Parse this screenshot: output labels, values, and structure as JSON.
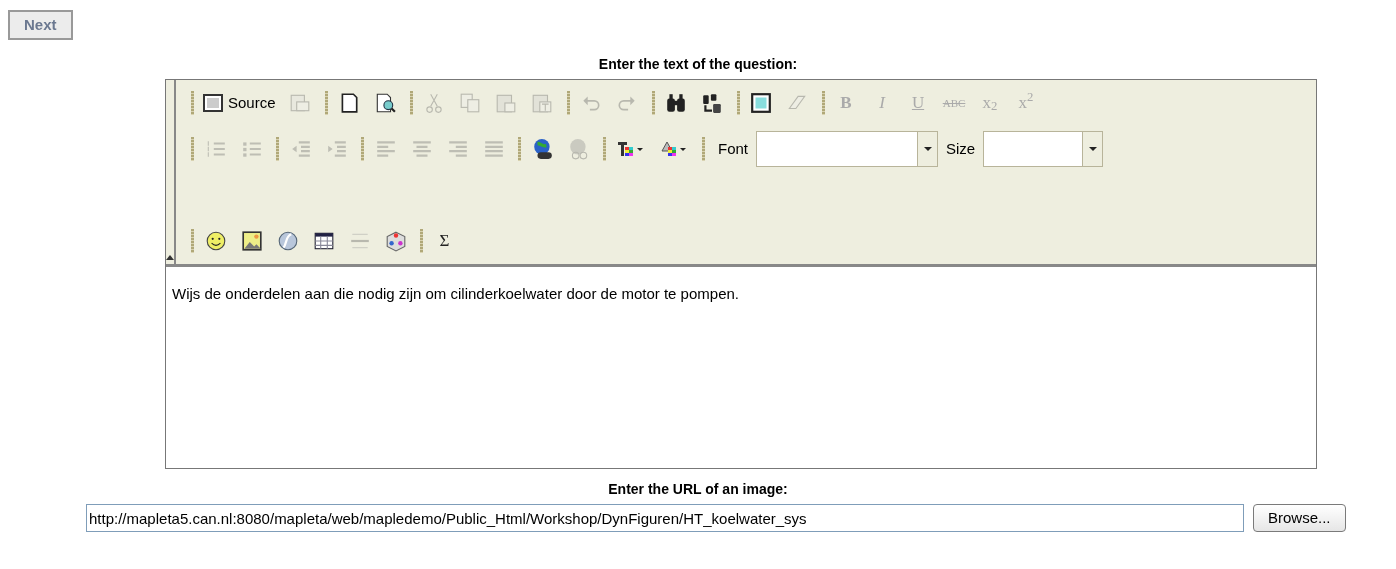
{
  "next_button": {
    "label": "Next",
    "disabled": true
  },
  "question_label": "Enter the text of the question:",
  "editor": {
    "toolbar_rows": [
      {
        "groups": [
          {
            "items": [
              {
                "kind": "text-button",
                "label": "Source",
                "disabled": false
              },
              {
                "kind": "icon",
                "disabled": true
              }
            ]
          },
          {
            "items": [
              {
                "kind": "icon",
                "disabled": false
              },
              {
                "kind": "icon",
                "disabled": false
              }
            ]
          },
          {
            "items": [
              {
                "kind": "icon",
                "disabled": true
              },
              {
                "kind": "icon",
                "disabled": true
              },
              {
                "kind": "icon",
                "disabled": true
              },
              {
                "kind": "icon",
                "disabled": true
              }
            ]
          },
          {
            "items": [
              {
                "kind": "icon",
                "disabled": true
              },
              {
                "kind": "icon",
                "disabled": true
              }
            ]
          },
          {
            "items": [
              {
                "kind": "icon",
                "disabled": false
              },
              {
                "kind": "icon",
                "disabled": false
              }
            ]
          },
          {
            "items": [
              {
                "kind": "icon",
                "disabled": false
              },
              {
                "kind": "icon",
                "disabled": true
              }
            ]
          },
          {
            "items": [
              {
                "kind": "glyph",
                "glyph": "B",
                "disabled": true
              },
              {
                "kind": "glyph",
                "glyph": "I",
                "disabled": true
              },
              {
                "kind": "glyph",
                "glyph": "U",
                "disabled": true
              },
              {
                "kind": "glyph",
                "glyph": "ABC",
                "disabled": true
              },
              {
                "kind": "glyph",
                "glyph": "x$_{2}$",
                "disabled": true
              },
              {
                "kind": "glyph",
                "glyph": "x$^{2}$",
                "disabled": true
              }
            ]
          }
        ]
      },
      {
        "groups": [
          {
            "items": [
              {
                "kind": "icon",
                "disabled": true
              },
              {
                "kind": "icon",
                "disabled": true
              }
            ]
          },
          {
            "items": [
              {
                "kind": "icon",
                "disabled": true
              },
              {
                "kind": "icon",
                "disabled": true
              }
            ]
          },
          {
            "items": [
              {
                "kind": "icon",
                "disabled": true
              },
              {
                "kind": "icon",
                "disabled": true
              },
              {
                "kind": "icon",
                "disabled": true
              },
              {
                "kind": "icon",
                "disabled": true
              }
            ]
          },
          {
            "items": [
              {
                "kind": "icon",
                "disabled": false
              },
              {
                "kind": "icon",
                "disabled": true
              }
            ]
          },
          {
            "items": [
              {
                "kind": "color-dropdown",
                "disabled": false
              },
              {
                "kind": "color-dropdown",
                "disabled": false
              }
            ]
          },
          {
            "items": [
              {
                "kind": "combo",
                "label": "Font"
              },
              {
                "kind": "combo",
                "label": "Size"
              }
            ]
          }
        ]
      },
      {
        "groups": []
      },
      {
        "groups": [
          {
            "items": [
              {
                "kind": "icon",
                "disabled": false
              },
              {
                "kind": "icon",
                "disabled": false
              },
              {
                "kind": "icon",
                "disabled": false
              },
              {
                "kind": "icon",
                "disabled": false
              },
              {
                "kind": "icon",
                "disabled": true
              },
              {
                "kind": "icon",
                "disabled": false
              }
            ]
          },
          {
            "items": [
              {
                "kind": "glyph",
                "glyph": "Σ",
                "disabled": false
              }
            ]
          }
        ]
      }
    ],
    "content": "Wijs de onderdelen aan die nodig zijn om cilinderkoelwater door de motor te pompen."
  },
  "image_label": "Enter the URL of an image:",
  "image_url": {
    "value": "http://mapleta5.can.nl:8080/mapleta/web/mapledemo/Public_Html/Workshop/DynFiguren/HT_koelwater_sys"
  },
  "browse_button": "Browse..."
}
